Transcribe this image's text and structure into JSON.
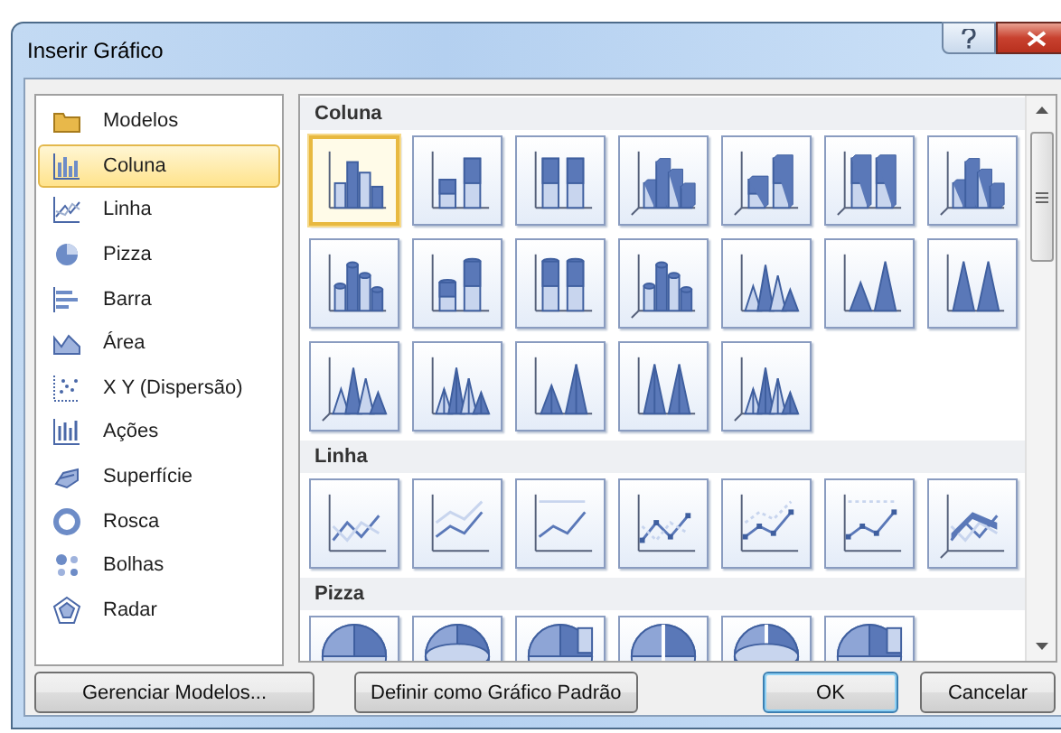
{
  "window": {
    "title": "Inserir Gráfico"
  },
  "chart_types": [
    {
      "label": "Modelos",
      "selected": false
    },
    {
      "label": "Coluna",
      "selected": true
    },
    {
      "label": "Linha",
      "selected": false
    },
    {
      "label": "Pizza",
      "selected": false
    },
    {
      "label": "Barra",
      "selected": false
    },
    {
      "label": "Área",
      "selected": false
    },
    {
      "label": "X Y (Dispersão)",
      "selected": false
    },
    {
      "label": "Ações",
      "selected": false
    },
    {
      "label": "Superfície",
      "selected": false
    },
    {
      "label": "Rosca",
      "selected": false
    },
    {
      "label": "Bolhas",
      "selected": false
    },
    {
      "label": "Radar",
      "selected": false
    }
  ],
  "gallery": {
    "sections": [
      {
        "title": "Coluna",
        "tiles": [
          {
            "kind": "clustered-column",
            "selected": true
          },
          {
            "kind": "stacked-column",
            "selected": false
          },
          {
            "kind": "stacked-column-100",
            "selected": false
          },
          {
            "kind": "clustered-column-3d",
            "selected": false
          },
          {
            "kind": "stacked-column-3d",
            "selected": false
          },
          {
            "kind": "stacked-column-100-3d",
            "selected": false
          },
          {
            "kind": "column-3d",
            "selected": false
          },
          {
            "kind": "clustered-cylinder",
            "selected": false
          },
          {
            "kind": "stacked-cylinder",
            "selected": false
          },
          {
            "kind": "stacked-cylinder-100",
            "selected": false
          },
          {
            "kind": "cylinder-3d",
            "selected": false
          },
          {
            "kind": "clustered-cone",
            "selected": false
          },
          {
            "kind": "stacked-cone",
            "selected": false
          },
          {
            "kind": "stacked-cone-100",
            "selected": false
          },
          {
            "kind": "cone-3d",
            "selected": false
          },
          {
            "kind": "clustered-pyramid",
            "selected": false
          },
          {
            "kind": "stacked-pyramid",
            "selected": false
          },
          {
            "kind": "stacked-pyramid-100",
            "selected": false
          },
          {
            "kind": "pyramid-3d",
            "selected": false
          }
        ]
      },
      {
        "title": "Linha",
        "tiles": [
          {
            "kind": "line",
            "selected": false
          },
          {
            "kind": "stacked-line",
            "selected": false
          },
          {
            "kind": "stacked-line-100",
            "selected": false
          },
          {
            "kind": "line-markers",
            "selected": false
          },
          {
            "kind": "stacked-line-markers",
            "selected": false
          },
          {
            "kind": "stacked-line-100-markers",
            "selected": false
          },
          {
            "kind": "line-3d",
            "selected": false
          }
        ]
      },
      {
        "title": "Pizza",
        "tiles": [
          {
            "kind": "pie",
            "selected": false
          },
          {
            "kind": "pie-3d",
            "selected": false
          },
          {
            "kind": "pie-of-pie",
            "selected": false
          },
          {
            "kind": "exploded-pie",
            "selected": false
          },
          {
            "kind": "exploded-pie-3d",
            "selected": false
          },
          {
            "kind": "bar-of-pie",
            "selected": false
          }
        ]
      }
    ]
  },
  "buttons": [
    {
      "label": "Gerenciar Modelos...",
      "default": false
    },
    {
      "label": "Definir como Gráfico Padrão",
      "default": false
    },
    {
      "label": "OK",
      "default": true
    },
    {
      "label": "Cancelar",
      "default": false
    }
  ]
}
